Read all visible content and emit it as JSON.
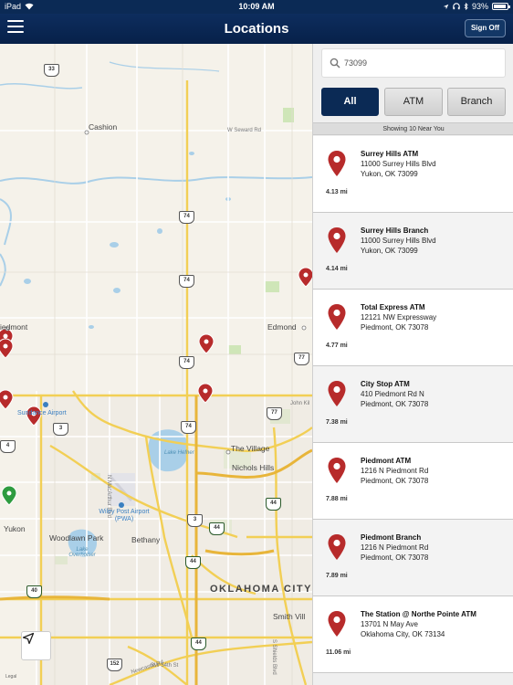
{
  "status_bar": {
    "device": "iPad",
    "time": "10:09 AM",
    "battery": "93%"
  },
  "nav": {
    "title": "Locations",
    "sign_off": "Sign Off"
  },
  "search": {
    "value": "73099",
    "placeholder": "73099"
  },
  "filters": [
    {
      "label": "All",
      "active": true
    },
    {
      "label": "ATM",
      "active": false
    },
    {
      "label": "Branch",
      "active": false
    }
  ],
  "results_header": "Showing 10 Near You",
  "locations": [
    {
      "name": "Surrey Hills ATM",
      "address1": "11000 Surrey Hills Blvd",
      "address2": "Yukon, OK 73099",
      "distance": "4.13 mi"
    },
    {
      "name": "Surrey Hills Branch",
      "address1": "11000 Surrey Hills Blvd",
      "address2": "Yukon, OK 73099",
      "distance": "4.14 mi"
    },
    {
      "name": "Total Express ATM",
      "address1": "12121 NW Expressway",
      "address2": "Piedmont, OK 73078",
      "distance": "4.77 mi"
    },
    {
      "name": "City Stop ATM",
      "address1": "410 Piedmont Rd N",
      "address2": "Piedmont, OK 73078",
      "distance": "7.38 mi"
    },
    {
      "name": "Piedmont ATM",
      "address1": "1216 N Piedmont Rd",
      "address2": "Piedmont, OK 73078",
      "distance": "7.88 mi"
    },
    {
      "name": "Piedmont Branch",
      "address1": "1216 N Piedmont Rd",
      "address2": "Piedmont, OK 73078",
      "distance": "7.89 mi"
    },
    {
      "name": "The Station @ Northe Pointe ATM",
      "address1": "13701 N May Ave",
      "address2": "Oklahoma City, OK 73134",
      "distance": "11.06 mi"
    }
  ],
  "map": {
    "labels": {
      "cashion": "Cashion",
      "seward": "W Seward Rd",
      "piedmont": "iedmont",
      "edmond": "Edmond",
      "john_kil": "John Kil",
      "sundance": "Sundance Airport",
      "the_village": "The Village",
      "lake_hefner": "Lake Hefner",
      "nichols_hills": "Nichols Hills",
      "n_macarthur": "N MacArthur Blvd",
      "wiley_post": "Wiley Post Airport (PWA)",
      "yukon": "Yukon",
      "woodlawn": "Woodlawn Park",
      "bethany": "Bethany",
      "lake_overholser": "Lake Overholser",
      "okc": "OKLAHOMA CITY",
      "smith_vill": "Smith Vill",
      "newcastle": "Newcastle Rd",
      "sw54": "SW 54th St",
      "s_shields": "S Shields Blvd",
      "legal": "Legal"
    },
    "shields": {
      "s33": "33",
      "s74a": "74",
      "s74b": "74",
      "s74c": "74",
      "s74d": "74",
      "s77a": "77",
      "s77b": "77",
      "s3a": "3",
      "s3b": "3",
      "s4": "4",
      "s44a": "44",
      "s44b": "44",
      "s44c": "44",
      "s44d": "44",
      "s40": "40",
      "s152": "152"
    },
    "pin_color": "#b72b2b",
    "user_pin_color": "#2e9b3f"
  },
  "colors": {
    "nav_bg": "#0b2a55",
    "pin": "#b72b2b",
    "active_filter": "#0b2a55"
  }
}
